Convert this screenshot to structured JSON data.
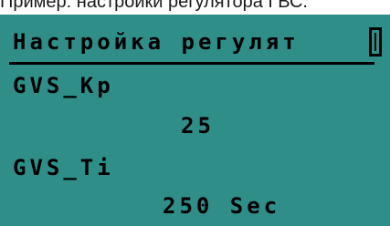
{
  "caption": "Пример: настройки регулятора ГВС.",
  "screen": {
    "header_title": "Настройка регулят",
    "params": [
      {
        "name": "GVS_Kp",
        "value": "25"
      },
      {
        "name": "GVS_Ti",
        "value": "250 Sec"
      }
    ],
    "cursor_icon": "scroll-cursor-icon",
    "colors": {
      "lcd_background": "#2f8e88",
      "lcd_text": "#000000"
    }
  }
}
